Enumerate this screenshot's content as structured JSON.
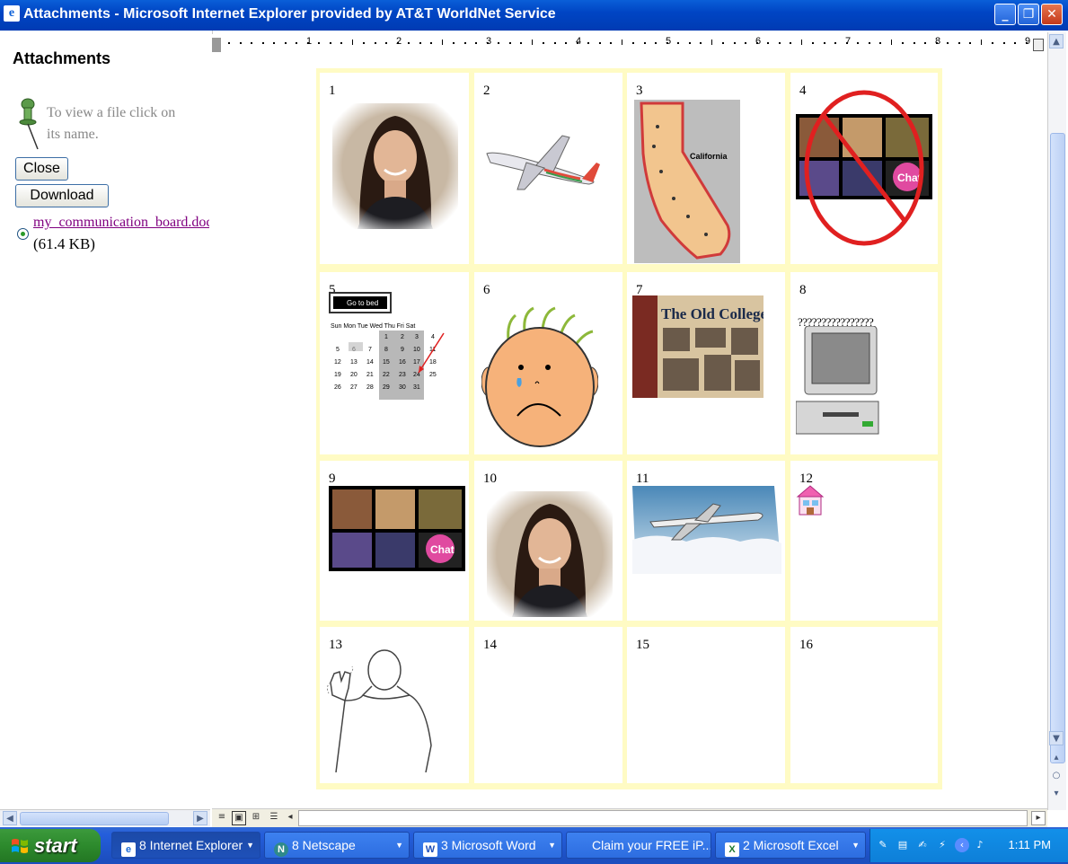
{
  "window": {
    "title": "Attachments - Microsoft Internet Explorer provided by AT&T WorldNet Service",
    "min": "_",
    "max": "❐",
    "close": "✕"
  },
  "sidebar": {
    "title": "Attachments",
    "hint": "To view a file click on its name.",
    "close_label": "Close",
    "download_label": "Download",
    "file_name": "my_communication_board.doc",
    "file_size": "(61.4 KB)"
  },
  "ruler": {
    "numbers": [
      "1",
      "2",
      "3",
      "4",
      "5",
      "6",
      "7",
      "8",
      "9"
    ]
  },
  "board": {
    "cells": [
      {
        "num": "1",
        "content": "woman-photo"
      },
      {
        "num": "2",
        "content": "airplane"
      },
      {
        "num": "3",
        "content": "california-map"
      },
      {
        "num": "4",
        "content": "no-chat"
      },
      {
        "num": "5",
        "content": "calendar"
      },
      {
        "num": "6",
        "content": "sad-face"
      },
      {
        "num": "7",
        "content": "old-college-try"
      },
      {
        "num": "8",
        "content": "computer"
      },
      {
        "num": "9",
        "content": "chat-collage"
      },
      {
        "num": "10",
        "content": "woman-photo"
      },
      {
        "num": "11",
        "content": "airplane-clouds"
      },
      {
        "num": "12",
        "content": "house"
      },
      {
        "num": "13",
        "content": "sign-language"
      },
      {
        "num": "14",
        "content": ""
      },
      {
        "num": "15",
        "content": ""
      },
      {
        "num": "16",
        "content": ""
      }
    ],
    "cell8_text": "????????????????",
    "cell7_title": "The Old College Try",
    "cell3_label": "California",
    "cell5_button": "Go to bed",
    "cell5_days": "Sun Mon Tue Wed Thu  Fri  Sat",
    "cell4_chat": "Chat"
  },
  "taskbar": {
    "start_label": "start",
    "tasks": [
      {
        "label": "8 Internet Explorer"
      },
      {
        "label": "8 Netscape"
      },
      {
        "label": "3 Microsoft Word"
      },
      {
        "label": "Claim your FREE iP..."
      },
      {
        "label": "2 Microsoft Excel"
      }
    ],
    "clock": "1:11 PM"
  },
  "colors": {
    "titlebar": "#0045c4",
    "table_border": "#fffbc4",
    "link_visited": "#800080",
    "start_green": "#2d8a2d",
    "taskbar_blue": "#245edb"
  }
}
